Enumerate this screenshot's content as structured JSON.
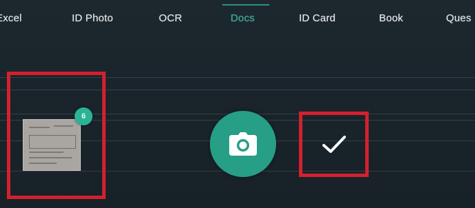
{
  "mode_tabs": [
    {
      "label": "Excel",
      "active": false
    },
    {
      "label": "ID Photo",
      "active": false
    },
    {
      "label": "OCR",
      "active": false
    },
    {
      "label": "Docs",
      "active": true
    },
    {
      "label": "ID Card",
      "active": false
    },
    {
      "label": "Book",
      "active": false
    },
    {
      "label": "Ques",
      "active": false
    }
  ],
  "gallery": {
    "badge_count": "6"
  },
  "icons": {
    "shutter": "camera-icon",
    "confirm": "checkmark-icon"
  },
  "colors": {
    "accent": "#2fae95",
    "shutter": "#279e86",
    "highlight_border": "#d3202f",
    "background": "#1b262c"
  }
}
